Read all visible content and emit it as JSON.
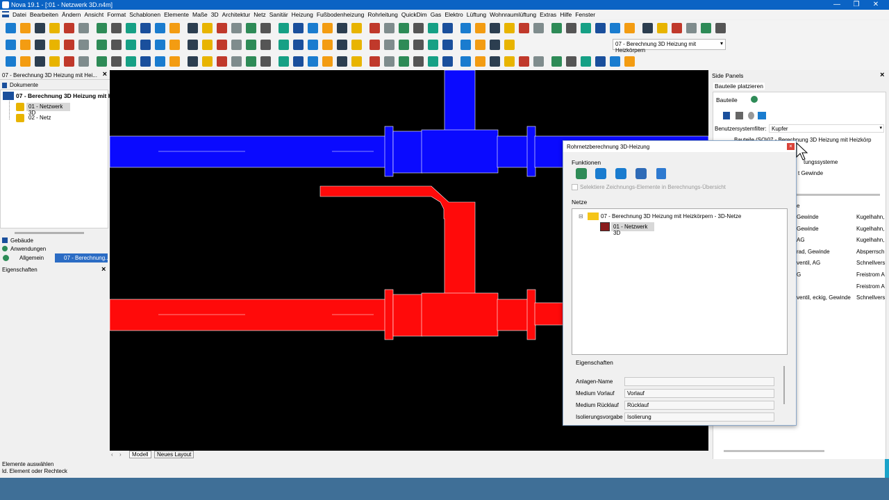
{
  "window": {
    "title": "Nova 19.1 - [:01 - Netzwerk 3D.n4m]",
    "minimize": "—",
    "maximize": "❐",
    "close": "✕"
  },
  "menu": [
    "Datei",
    "Bearbeiten",
    "Ändern",
    "Ansicht",
    "Format",
    "Schablonen",
    "Elemente",
    "Maße",
    "3D",
    "Architektur",
    "Netz",
    "Sanitär",
    "Heizung",
    "Fußbodenheizung",
    "Rohrleitung",
    "QuickDim",
    "Gas",
    "Elektro",
    "Lüftung",
    "Wohnraumlüftung",
    "Extras",
    "Hilfe",
    "Fenster"
  ],
  "toolbar": {
    "layer_select": "07 - Berechnung 3D Heizung mit Heizkörpern"
  },
  "left": {
    "doc_title": "07 - Berechnung 3D Heizung mit Hei...",
    "dokumente": "Dokumente",
    "root": "07 - Berechnung 3D Heizung mit He",
    "items": [
      "01 - Netzwerk 3D",
      "02 - Netz"
    ],
    "gebaeude": "Gebäude",
    "anwendungen": "Anwendungen",
    "allgemein": "Allgemein",
    "anw_value": "07 - Berechnung...",
    "eigenschaften": "Eigenschaften"
  },
  "tabs": {
    "modell": "Modell",
    "layout": "Neues Layout"
  },
  "status": {
    "line1": "Elemente auswählen",
    "line2": "ld. Element oder Rechteck"
  },
  "right": {
    "side_panels": "Side Panels",
    "tab": "Bauteile platzieren",
    "subtab": "Bauteile",
    "filter_label": "Benutzersystemfilter:",
    "filter_value": "Kupfer",
    "tree_line": "Bauteile (SO\\07 - Berechnung 3D Heizung mit Heizkörp",
    "tree2": "tungssysteme",
    "tree3": "t Gewinde",
    "col_head": "e",
    "rows": [
      {
        "a": "Gewinde",
        "b": "Kugelhahn,"
      },
      {
        "a": "Gewinde",
        "b": "Kugelhahn,"
      },
      {
        "a": "AG",
        "b": "Kugelhahn,"
      },
      {
        "a": "rad, Gewinde",
        "b": "Absperrsch"
      },
      {
        "a": "ventil, AG",
        "b": "Schnellvers"
      },
      {
        "a": "G",
        "b": "Freistrom A"
      },
      {
        "a": "",
        "b": "Freistrom A"
      },
      {
        "a": "ventil, eckig, Gewinde",
        "b": "Schnellvers"
      }
    ]
  },
  "dialog": {
    "title": "Rohrnetzberechnung 3D-Heizung",
    "funktionen": "Funktionen",
    "checkbox": "Selektiere Zeichnungs-Elemente in Berechnungs-Übersicht",
    "netze": "Netze",
    "net_root": "07 - Berechnung 3D Heizung mit Heizkörpern - 3D-Netze",
    "net_child": "01 - Netzwerk 3D",
    "eigenschaften": "Eigenschaften",
    "props": [
      {
        "label": "Anlagen-Name",
        "value": ""
      },
      {
        "label": "Medium Vorlauf",
        "value": "Vorlauf"
      },
      {
        "label": "Medium Rücklauf",
        "value": "Rücklauf"
      },
      {
        "label": "Isolierungsvorgabe",
        "value": "Isolierung"
      }
    ]
  },
  "colors": {
    "supply": "#0a0aff",
    "return": "#ff0a0a",
    "titlebar": "#0b63c4",
    "status": "#3f6f97"
  }
}
